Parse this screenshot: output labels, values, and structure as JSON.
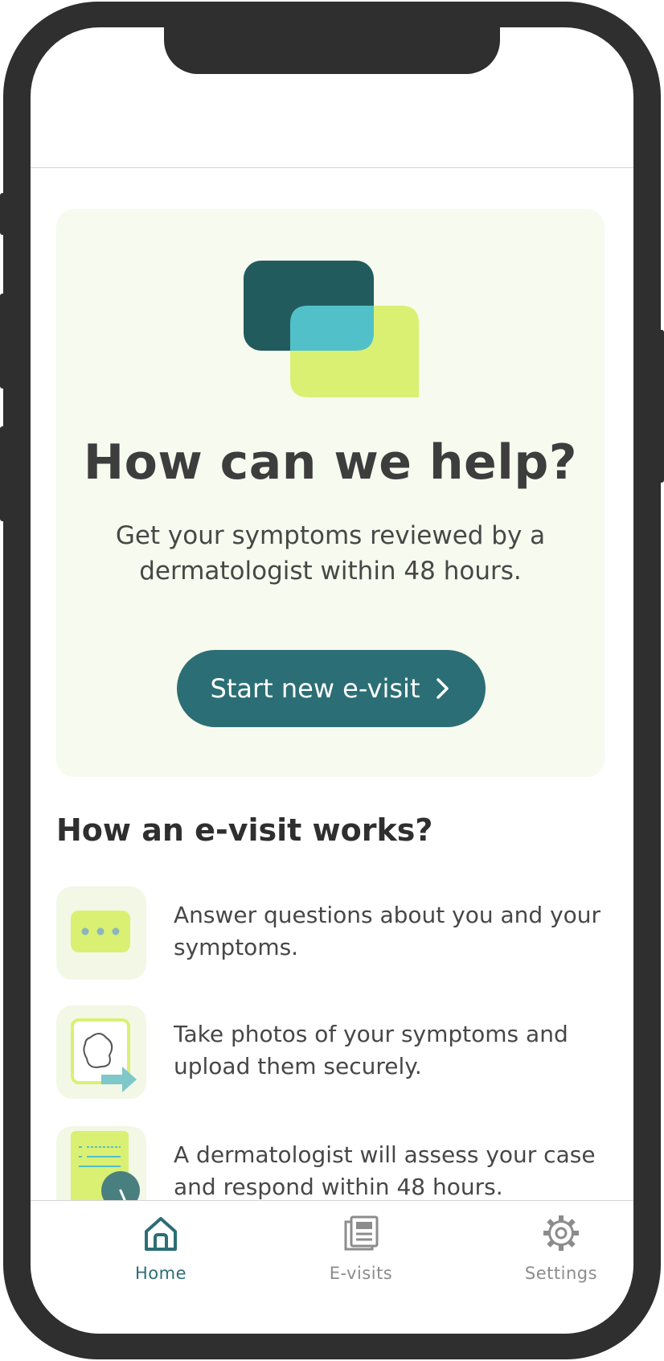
{
  "hero": {
    "title": "How can we help?",
    "subtitle": "Get your symptoms reviewed by a dermatologist within 48 hours.",
    "cta_label": "Start new e-visit"
  },
  "how_it_works": {
    "title": "How an e-visit works?",
    "steps": [
      {
        "text": "Answer questions about you and your symptoms.",
        "icon": "chat-bubble-icon"
      },
      {
        "text": "Take photos of your symptoms and upload them securely.",
        "icon": "photo-upload-icon"
      },
      {
        "text": "A dermatologist will assess your case and respond within 48 hours.",
        "icon": "document-clock-icon"
      }
    ]
  },
  "tabbar": {
    "items": [
      {
        "label": "Home",
        "icon": "home-icon",
        "active": true
      },
      {
        "label": "E-visits",
        "icon": "documents-icon",
        "active": false
      },
      {
        "label": "Settings",
        "icon": "gear-icon",
        "active": false
      }
    ]
  },
  "colors": {
    "primary": "#2c6e75",
    "dark_teal": "#225b5e",
    "light_teal": "#52c0c8",
    "lime": "#d9f073",
    "hero_bg": "#f7faee",
    "text": "#474747"
  }
}
